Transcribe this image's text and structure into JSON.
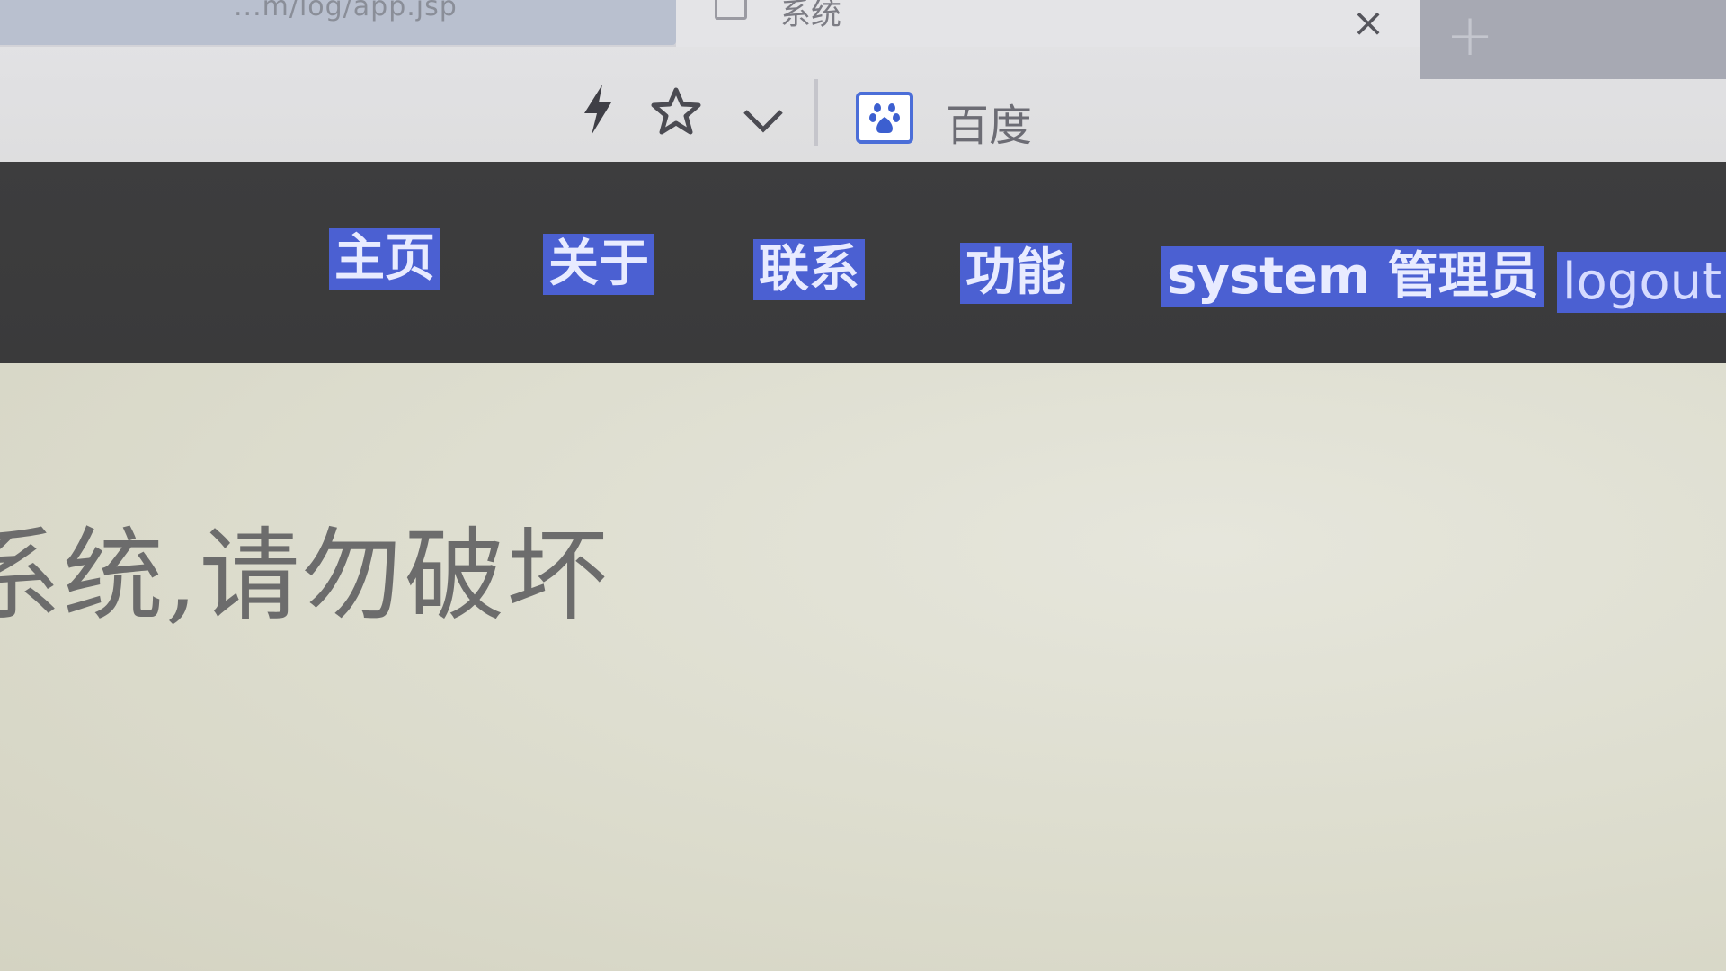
{
  "browser": {
    "inactive_tab": {
      "title": "...m/log/app.jsp"
    },
    "active_tab": {
      "title": "系统",
      "close_icon": "close-icon"
    },
    "new_tab_icon": "plus-icon",
    "toolbar": {
      "icons": [
        "lightning-icon",
        "star-icon",
        "chevron-down-icon"
      ],
      "search_engine": {
        "icon": "baidu-paw-icon",
        "label": "百度"
      }
    }
  },
  "nav": {
    "items": [
      {
        "label": "主页"
      },
      {
        "label": "关于"
      },
      {
        "label": "联系"
      },
      {
        "label": "功能"
      },
      {
        "label": "system 管理员"
      },
      {
        "label": "logout"
      }
    ],
    "highlight_color": "#4b60d2",
    "bar_color": "#3c3c3d"
  },
  "content": {
    "notice": "系统,请勿破坏"
  }
}
